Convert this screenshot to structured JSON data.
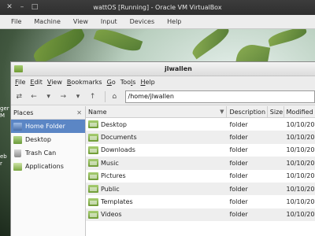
{
  "vbox": {
    "title": "wattOS [Running] - Oracle VM VirtualBox",
    "menu": [
      "File",
      "Machine",
      "View",
      "Input",
      "Devices",
      "Help"
    ]
  },
  "desktop": {
    "partial_labels": [
      "ger",
      "M",
      "eb",
      "r"
    ]
  },
  "filemanager": {
    "title": "jlwallen",
    "menu": [
      {
        "label": "File",
        "accel": "F",
        "rest": "ile"
      },
      {
        "label": "Edit",
        "accel": "E",
        "rest": "dit"
      },
      {
        "label": "View",
        "accel": "V",
        "rest": "iew"
      },
      {
        "label": "Bookmarks",
        "accel": "B",
        "rest": "ookmarks"
      },
      {
        "label": "Go",
        "accel": "G",
        "rest": "o"
      },
      {
        "label": "Tools",
        "pre": "Too",
        "accel": "l",
        "rest": "s"
      },
      {
        "label": "Help",
        "accel": "H",
        "rest": "elp"
      }
    ],
    "path": "/home/jlwallen",
    "sidebar": {
      "header": "Places",
      "close": "✕",
      "items": [
        {
          "label": "Home Folder",
          "icon": "home-icon",
          "selected": true
        },
        {
          "label": "Desktop",
          "icon": "desktop-icon"
        },
        {
          "label": "Trash Can",
          "icon": "trash-icon"
        },
        {
          "label": "Applications",
          "icon": "applications-icon"
        }
      ]
    },
    "columns": [
      "Name",
      "Description",
      "Size",
      "Modified"
    ],
    "files": [
      {
        "name": "Desktop",
        "description": "folder",
        "size": "",
        "modified": "10/10/20"
      },
      {
        "name": "Documents",
        "description": "folder",
        "size": "",
        "modified": "10/10/20"
      },
      {
        "name": "Downloads",
        "description": "folder",
        "size": "",
        "modified": "10/10/20"
      },
      {
        "name": "Music",
        "description": "folder",
        "size": "",
        "modified": "10/10/20"
      },
      {
        "name": "Pictures",
        "description": "folder",
        "size": "",
        "modified": "10/10/20"
      },
      {
        "name": "Public",
        "description": "folder",
        "size": "",
        "modified": "10/10/20"
      },
      {
        "name": "Templates",
        "description": "folder",
        "size": "",
        "modified": "10/10/20"
      },
      {
        "name": "Videos",
        "description": "folder",
        "size": "",
        "modified": "10/10/20"
      }
    ]
  }
}
